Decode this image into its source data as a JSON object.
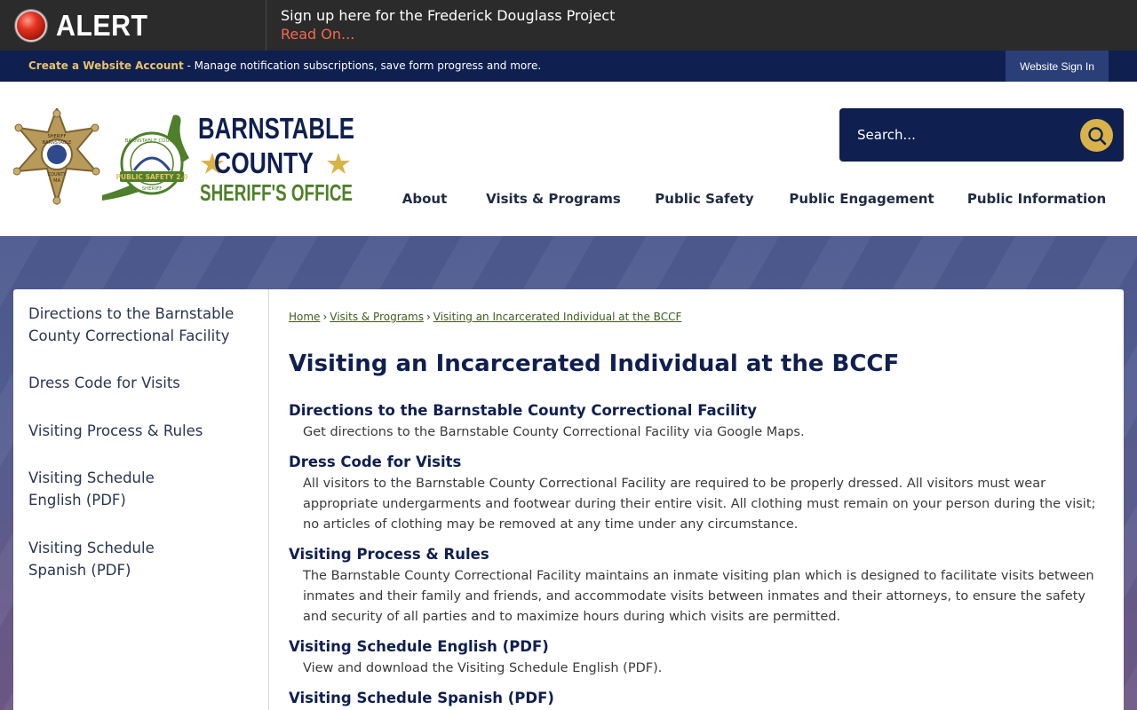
{
  "alert": {
    "title": "ALERT",
    "message": "Sign up here for the Frederick Douglass Project",
    "link": "Read On..."
  },
  "account": {
    "create_link": "Create a Website Account",
    "description": " - Manage notification subscriptions, save form progress and more.",
    "sign_in": "Website Sign In"
  },
  "logo": {
    "line1": "BARNSTABLE",
    "line2": "COUNTY",
    "line3": "SHERIFF'S OFFICE",
    "badge_text_top": "SHERIFF",
    "badge_text_mid": "BARNSTABLE",
    "badge_text_bottom": "COUNTY",
    "badge_state": "MA",
    "seal_text": "PUBLIC SAFETY 2.0",
    "seal_ring": "BARNSTABLE COUNTY",
    "seal_bottom": "SHERIFF"
  },
  "search": {
    "placeholder": "Search..."
  },
  "nav": [
    {
      "label": "About"
    },
    {
      "label": "Visits & Programs"
    },
    {
      "label": "Public Safety"
    },
    {
      "label": "Public Engagement"
    },
    {
      "label": "Public Information"
    }
  ],
  "sidebar": [
    {
      "label": "Directions to the Barnstable County Correctional Facility"
    },
    {
      "label": "Dress Code for Visits"
    },
    {
      "label": "Visiting Process & Rules"
    },
    {
      "label": "Visiting Schedule English (PDF)"
    },
    {
      "label": "Visiting Schedule Spanish (PDF)"
    }
  ],
  "breadcrumb": [
    {
      "label": "Home"
    },
    {
      "label": "Visits & Programs"
    },
    {
      "label": "Visiting an Incarcerated Individual at the BCCF"
    }
  ],
  "breadcrumb_separator": "›",
  "page_title": "Visiting an Incarcerated Individual at the BCCF",
  "entries": [
    {
      "title": "Directions to the Barnstable County Correctional Facility",
      "description": "Get directions to the Barnstable County Correctional Facility via Google Maps."
    },
    {
      "title": "Dress Code for Visits",
      "description": "All visitors to the Barnstable County Correctional Facility are required to be properly dressed. All visitors must wear appropriate undergarments and footwear during their entire visit. All clothing must remain on your person during the visit; no articles of clothing may be removed at any time under any circumstance."
    },
    {
      "title": "Visiting Process & Rules",
      "description": "The Barnstable County Correctional Facility maintains an inmate visiting plan which is designed to facilitate visits between inmates and their family and friends, and accommodate visits between inmates and their attorneys, to ensure the safety and security of all parties and to maximize hours during which visits are permitted."
    },
    {
      "title": "Visiting Schedule English (PDF)",
      "description": "View and download the Visiting Schedule English (PDF)."
    },
    {
      "title": "Visiting Schedule Spanish (PDF)",
      "description": ""
    }
  ],
  "colors": {
    "navy": "#0f1f4f",
    "gold": "#d9b24a",
    "alert_link": "#f26a4f",
    "breadcrumb_link": "#3f5b1e",
    "logo_green": "#4f7f2a"
  }
}
